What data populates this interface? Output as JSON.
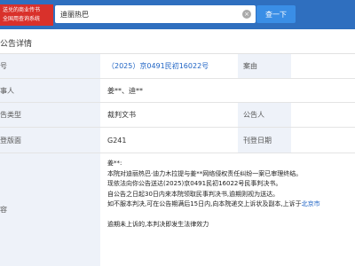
{
  "header": {
    "promo_line1": "送兑的商业传书",
    "promo_line2": "全国用查询系统",
    "search_value": "迪丽热巴",
    "clear_icon": "×",
    "search_button": "查一下"
  },
  "section": {
    "title": "公告详情"
  },
  "rows": {
    "case_no": {
      "label": "号",
      "value": "（2025）京0491民初16022号",
      "right_label": "案由",
      "right_value": ""
    },
    "party": {
      "label": "事人",
      "value": "姜**、迪**"
    },
    "type": {
      "label": "告类型",
      "value": "裁判文书",
      "right_label": "公告人",
      "right_value": ""
    },
    "page": {
      "label": "登版面",
      "value": "G241",
      "right_label": "刊登日期",
      "right_value": ""
    },
    "content": {
      "label": "容",
      "lines": [
        "姜**:",
        "本院对迪丽热巴·迪力木拉提与姜**网络侵权责任纠纷一案已审理终结。",
        "现依法向你公告送达(2025)京0491民初16022号民事判决书。",
        "自公告之日起30日内来本院领取民事判决书,逾期则视为送达。",
        "如不服本判决,可在公告期满后15日内,向本院递交上诉状及副本,上诉于",
        "北京市",
        "",
        "逾期未上诉的,本判决即发生法律效力"
      ]
    }
  }
}
